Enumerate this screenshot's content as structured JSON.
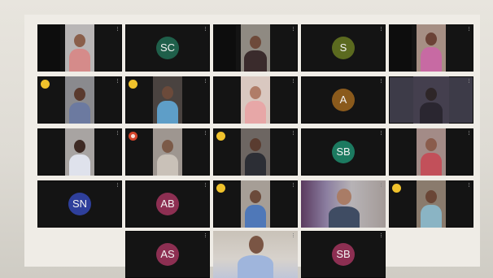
{
  "screen": {
    "avatars": {
      "sc": {
        "initials": "SC",
        "color": "#1f5f4a"
      },
      "s": {
        "initials": "S",
        "color": "#5b6a1f"
      },
      "a": {
        "initials": "A",
        "color": "#8a5a1c"
      },
      "sb1": {
        "initials": "SB",
        "color": "#1c7a60"
      },
      "sn": {
        "initials": "SN",
        "color": "#2e3f9b"
      },
      "ab": {
        "initials": "AB",
        "color": "#8d2f52"
      },
      "as": {
        "initials": "AS",
        "color": "#8d2f52"
      },
      "sb2": {
        "initials": "SB",
        "color": "#8d2f52"
      }
    },
    "hand_raised_color": "#f0c22c",
    "muted_badge_color": "#d4452b"
  }
}
